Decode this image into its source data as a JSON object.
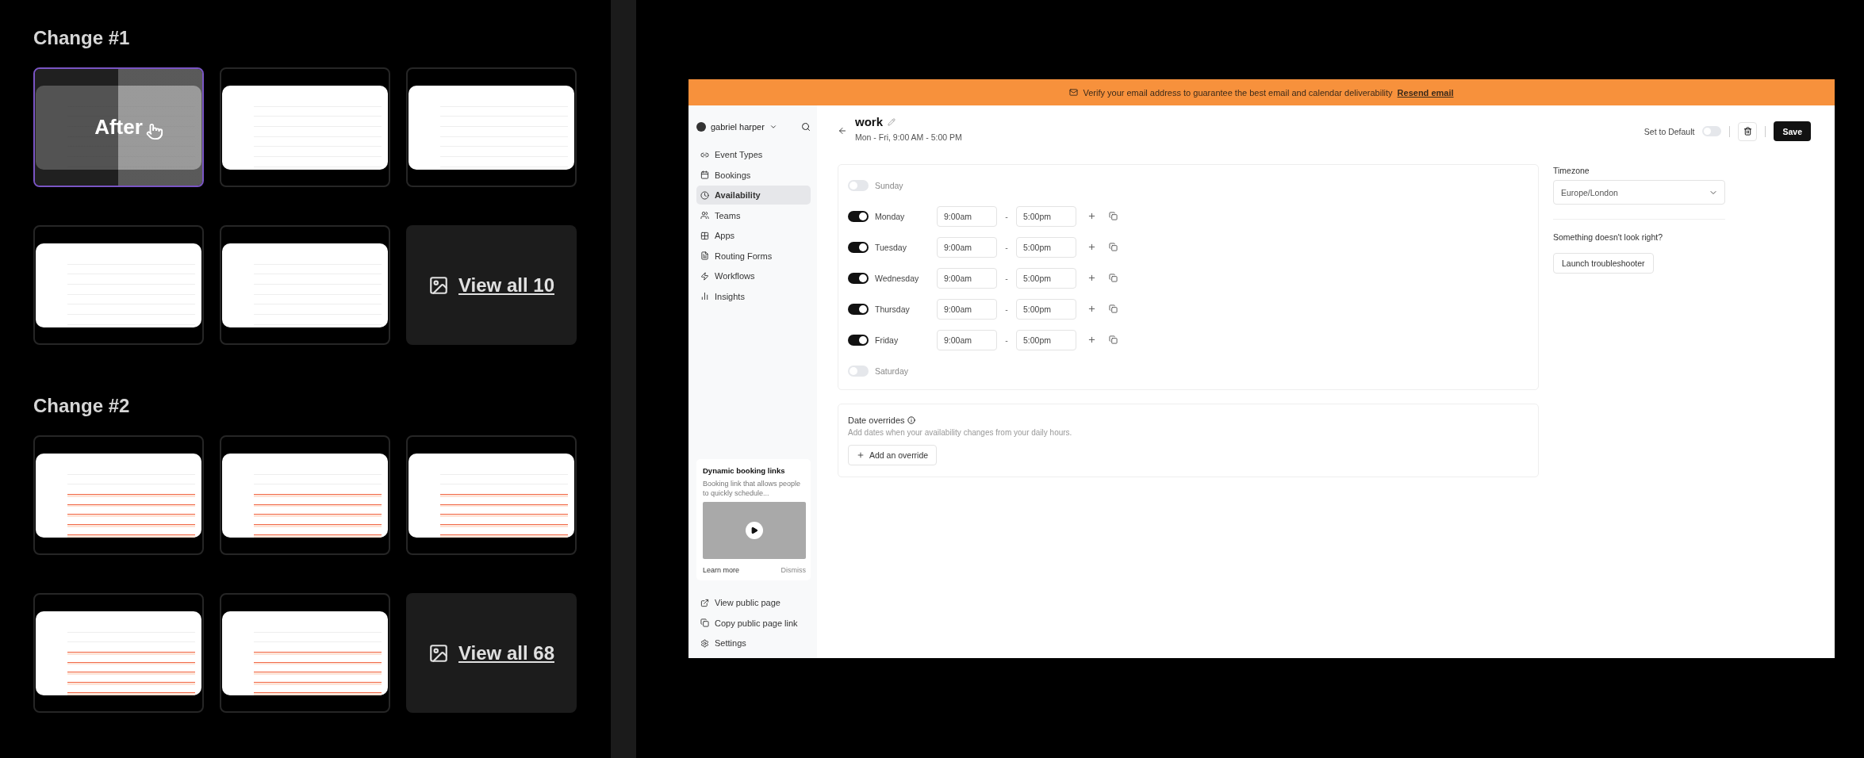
{
  "groups": [
    {
      "title": "Change #1",
      "thumbnails": [
        {
          "kind": "plain",
          "selected": true,
          "label": "After"
        },
        {
          "kind": "plain",
          "selected": false
        },
        {
          "kind": "plain",
          "selected": false
        },
        {
          "kind": "plain",
          "selected": false
        },
        {
          "kind": "plain",
          "selected": false
        }
      ],
      "view_all": "View all 10"
    },
    {
      "title": "Change #2",
      "thumbnails": [
        {
          "kind": "highlighted",
          "selected": false
        },
        {
          "kind": "highlighted",
          "selected": false
        },
        {
          "kind": "highlighted",
          "selected": false
        },
        {
          "kind": "highlighted",
          "selected": false
        },
        {
          "kind": "highlighted",
          "selected": false
        }
      ],
      "view_all": "View all 68"
    }
  ],
  "app": {
    "banner": {
      "text": "Verify your email address to guarantee the best email and calendar deliverability",
      "link": "Resend email"
    },
    "sidebar": {
      "user": "gabriel harper",
      "items": [
        {
          "label": "Event Types",
          "selected": false
        },
        {
          "label": "Bookings",
          "selected": false
        },
        {
          "label": "Availability",
          "selected": true
        },
        {
          "label": "Teams",
          "selected": false
        },
        {
          "label": "Apps",
          "selected": false
        },
        {
          "label": "Routing Forms",
          "selected": false
        },
        {
          "label": "Workflows",
          "selected": false
        },
        {
          "label": "Insights",
          "selected": false
        }
      ],
      "promo": {
        "title": "Dynamic booking links",
        "text": "Booking link that allows people to quickly schedule...",
        "learn_more": "Learn more",
        "dismiss": "Dismiss"
      },
      "footer_links": [
        "View public page",
        "Copy public page link",
        "Settings"
      ]
    },
    "header": {
      "title": "work",
      "subtitle": "Mon - Fri, 9:00 AM - 5:00 PM",
      "set_default_label": "Set to Default",
      "set_default_on": false,
      "save": "Save"
    },
    "days": [
      {
        "name": "Sunday",
        "on": false
      },
      {
        "name": "Monday",
        "on": true,
        "start": "9:00am",
        "separator": "-",
        "end": "5:00pm"
      },
      {
        "name": "Tuesday",
        "on": true,
        "start": "9:00am",
        "separator": "-",
        "end": "5:00pm"
      },
      {
        "name": "Wednesday",
        "on": true,
        "start": "9:00am",
        "separator": "-",
        "end": "5:00pm"
      },
      {
        "name": "Thursday",
        "on": true,
        "start": "9:00am",
        "separator": "-",
        "end": "5:00pm"
      },
      {
        "name": "Friday",
        "on": true,
        "start": "9:00am",
        "separator": "-",
        "end": "5:00pm"
      },
      {
        "name": "Saturday",
        "on": false
      }
    ],
    "overrides": {
      "title": "Date overrides",
      "description": "Add dates when your availability changes from your daily hours.",
      "button": "Add an override"
    },
    "timezone": {
      "label": "Timezone",
      "value": "Europe/London"
    },
    "troubleshoot": {
      "question": "Something doesn't look right?",
      "button": "Launch troubleshooter"
    }
  }
}
